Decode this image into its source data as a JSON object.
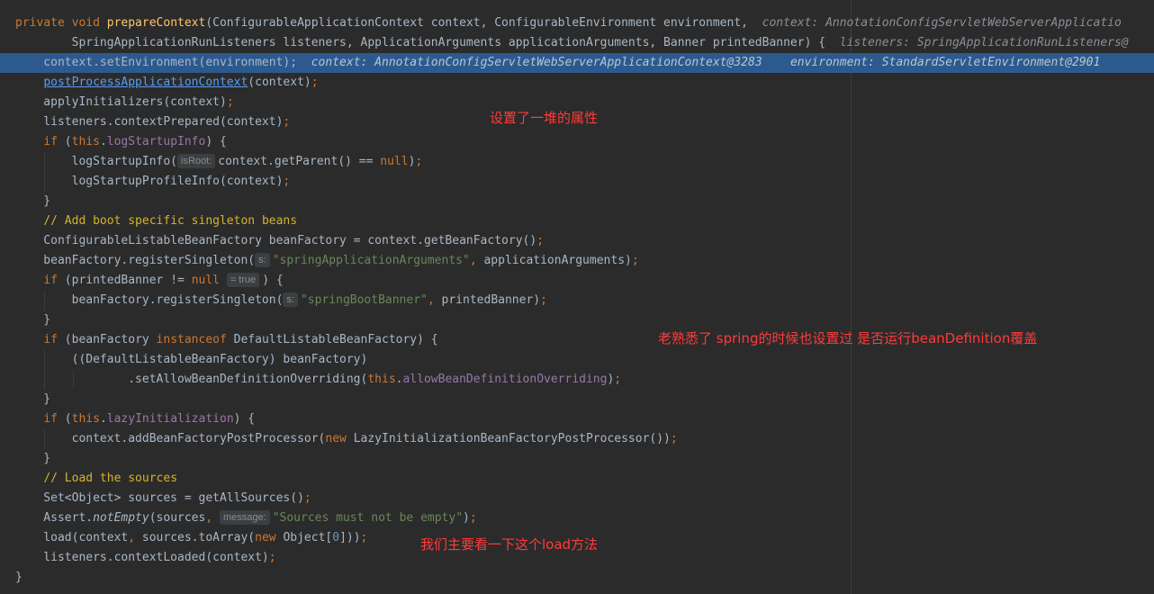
{
  "debug": {
    "line1": "context: AnnotationConfigServletWebServerApplicatio",
    "line2": "listeners: SpringApplicationRunListeners@",
    "line3_context": "context: AnnotationConfigServletWebServerApplicationContext@3283",
    "line3_env": "environment: StandardServletEnvironment@2901"
  },
  "hints": {
    "isRoot": "isRoot:",
    "s1": "s:",
    "eq_true": "= true",
    "s2": "s:",
    "message": "message:"
  },
  "notes": {
    "n1": "设置了一堆的属性",
    "n2": "老熟悉了 spring的时候也设置过 是否运行beanDefinition覆盖",
    "n3": "我们主要看一下这个load方法"
  },
  "colors": {
    "background": "#2b2b2b",
    "current_line": "#2d5a8e",
    "keyword": "#cc7832",
    "method_decl": "#ffc66d",
    "string": "#6a8759",
    "comment": "#d6b32c",
    "field": "#9876aa",
    "annotation_text": "#ff3b3b"
  }
}
